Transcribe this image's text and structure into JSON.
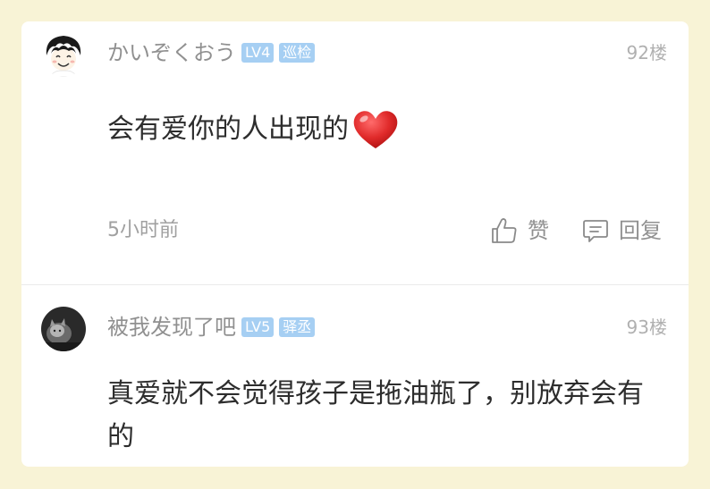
{
  "comments": [
    {
      "username": "かいぞくおう",
      "level": "LV4",
      "role": "巡检",
      "floor": "92楼",
      "text": "会有爱你的人出现的",
      "emoji": "heart-emoji",
      "time": "5小时前",
      "like_label": "赞",
      "reply_label": "回复"
    },
    {
      "username": "被我发现了吧",
      "level": "LV5",
      "role": "驿丞",
      "floor": "93楼",
      "text": "真爱就不会觉得孩子是拖油瓶了，别放弃会有的"
    }
  ],
  "colors": {
    "background": "#f8f3d6",
    "card": "#ffffff",
    "badge": "#a6cff3",
    "muted_text": "#909090",
    "body_text": "#2d2d2d",
    "heart": "#e02a2a"
  },
  "icons": [
    "thumbs-up-icon",
    "comment-icon"
  ]
}
